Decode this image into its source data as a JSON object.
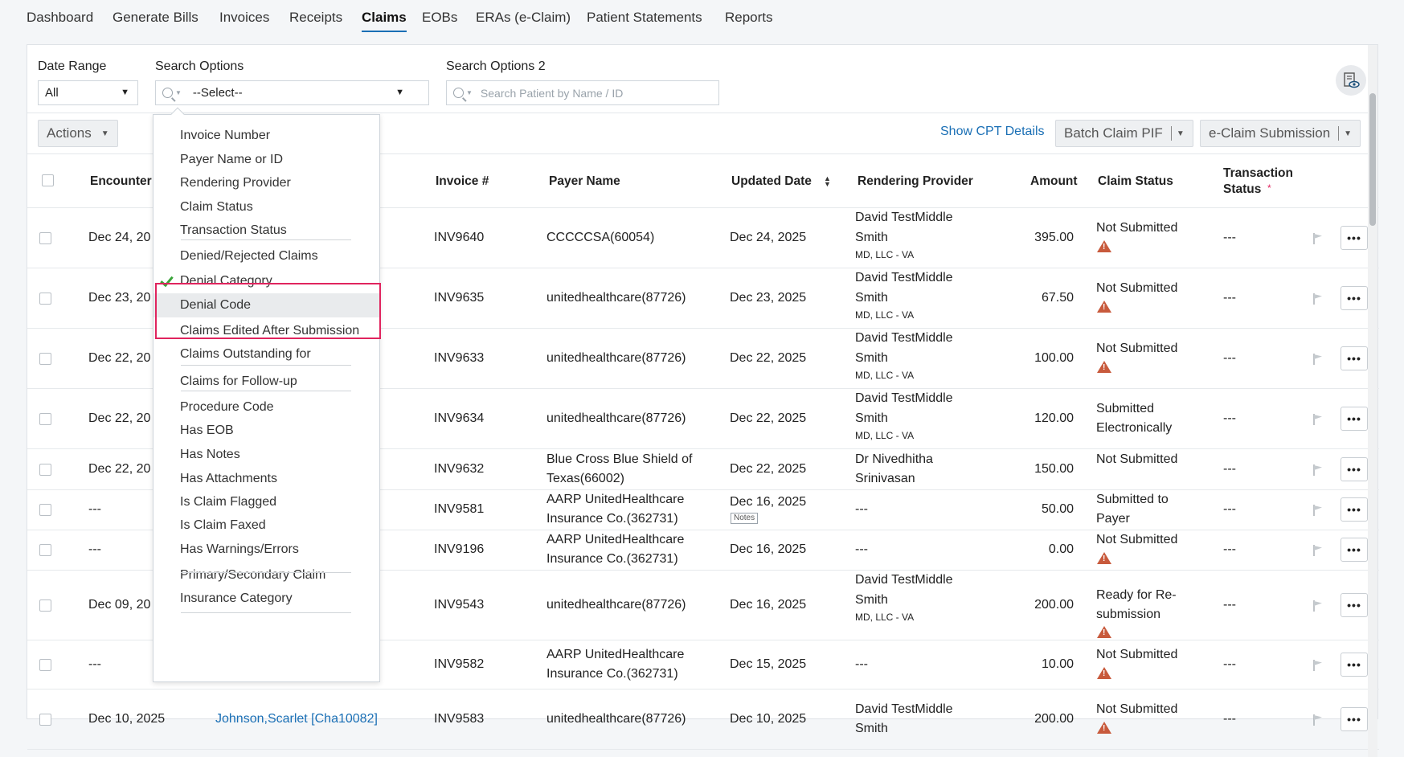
{
  "nav": {
    "tabs": [
      {
        "label": "Dashboard"
      },
      {
        "label": "Generate Bills"
      },
      {
        "label": "Invoices"
      },
      {
        "label": "Receipts"
      },
      {
        "label": "Claims"
      },
      {
        "label": "EOBs"
      },
      {
        "label": "ERAs (e-Claim)"
      },
      {
        "label": "Patient Statements"
      },
      {
        "label": "Reports"
      }
    ],
    "active": "Claims"
  },
  "filters": {
    "date_range_label": "Date Range",
    "date_range_value": "All",
    "search_options_label": "Search Options",
    "search_options_value": "--Select--",
    "search_options2_label": "Search Options 2",
    "search_options2_placeholder": "Search Patient by Name / ID"
  },
  "toolbar": {
    "actions_label": "Actions",
    "show_cpt_label": "Show CPT Details",
    "batch_claim_label": "Batch Claim PIF",
    "eclaim_label": "e-Claim Submission"
  },
  "table": {
    "headers": {
      "encounter": "Encounter",
      "invoice": "Invoice #",
      "payer": "Payer Name",
      "updated": "Updated Date",
      "provider": "Rendering Provider",
      "amount": "Amount",
      "claim_status": "Claim Status",
      "transaction_status_1": "Transaction",
      "transaction_status_2": "Status"
    },
    "rows": [
      {
        "encounter": "Dec 24, 20",
        "patient": "",
        "invoice": "INV9640",
        "payer1": "CCCCCSA(60054)",
        "payer2": "",
        "updated": "Dec 24, 2025",
        "prov1": "David TestMiddle",
        "prov2": "Smith",
        "prov3": "MD, LLC - VA",
        "amount": "395.00",
        "status1": "Not Submitted",
        "status2": "",
        "warn": true,
        "txn": "---"
      },
      {
        "encounter": "Dec 23, 20",
        "patient": "",
        "invoice": "INV9635",
        "payer1": "unitedhealthcare(87726)",
        "payer2": "",
        "updated": "Dec 23, 2025",
        "prov1": "David TestMiddle",
        "prov2": "Smith",
        "prov3": "MD, LLC - VA",
        "amount": "67.50",
        "status1": "Not Submitted",
        "status2": "",
        "warn": true,
        "txn": "---"
      },
      {
        "encounter": "Dec 22, 20",
        "patient": "",
        "invoice": "INV9633",
        "payer1": "unitedhealthcare(87726)",
        "payer2": "",
        "updated": "Dec 22, 2025",
        "prov1": "David TestMiddle",
        "prov2": "Smith",
        "prov3": "MD, LLC - VA",
        "amount": "100.00",
        "status1": "Not Submitted",
        "status2": "",
        "warn": true,
        "txn": "---"
      },
      {
        "encounter": "Dec 22, 20",
        "patient": "",
        "invoice": "INV9634",
        "payer1": "unitedhealthcare(87726)",
        "payer2": "",
        "updated": "Dec 22, 2025",
        "prov1": "David TestMiddle",
        "prov2": "Smith",
        "prov3": "MD, LLC - VA",
        "amount": "120.00",
        "status1": "Submitted",
        "status2": "Electronically",
        "warn": false,
        "txn": "---"
      },
      {
        "encounter": "Dec 22, 20",
        "patient": "",
        "invoice": "INV9632",
        "payer1": "Blue Cross Blue Shield of",
        "payer2": "Texas(66002)",
        "updated": "Dec 22, 2025",
        "prov1": "Dr Nivedhitha",
        "prov2": "Srinivasan",
        "prov3": "",
        "amount": "150.00",
        "status1": "Not Submitted",
        "status2": "",
        "warn": false,
        "txn": "---"
      },
      {
        "encounter": "---",
        "patient": "",
        "invoice": "INV9581",
        "payer1": "AARP UnitedHealthcare",
        "payer2": "Insurance Co.(362731)",
        "updated": "Dec 16, 2025",
        "notes": "Notes",
        "prov1": "---",
        "prov2": "",
        "prov3": "",
        "amount": "50.00",
        "status1": "Submitted to",
        "status2": "Payer",
        "warn": false,
        "txn": "---"
      },
      {
        "encounter": "---",
        "patient": "",
        "invoice": "INV9196",
        "payer1": "AARP UnitedHealthcare",
        "payer2": "Insurance Co.(362731)",
        "updated": "Dec 16, 2025",
        "prov1": "---",
        "prov2": "",
        "prov3": "",
        "amount": "0.00",
        "status1": "Not Submitted",
        "status2": "",
        "warn": true,
        "txn": "---"
      },
      {
        "encounter": "Dec 09, 20",
        "patient": "",
        "invoice": "INV9543",
        "payer1": "unitedhealthcare(87726)",
        "payer2": "",
        "updated": "Dec 16, 2025",
        "prov1": "David TestMiddle",
        "prov2": "Smith",
        "prov3": "MD, LLC - VA",
        "amount": "200.00",
        "status1": "Ready for Re-",
        "status2": "submission",
        "warn": true,
        "txn": "---"
      },
      {
        "encounter": "---",
        "patient": "",
        "invoice": "INV9582",
        "payer1": "AARP UnitedHealthcare",
        "payer2": "Insurance Co.(362731)",
        "updated": "Dec 15, 2025",
        "prov1": "---",
        "prov2": "",
        "prov3": "",
        "amount": "10.00",
        "status1": "Not Submitted",
        "status2": "",
        "warn": true,
        "txn": "---"
      },
      {
        "encounter": "Dec 10, 2025",
        "patient": "Johnson,Scarlet [Cha10082]",
        "invoice": "INV9583",
        "payer1": "unitedhealthcare(87726)",
        "payer2": "",
        "updated": "Dec 10, 2025",
        "prov1": "David TestMiddle",
        "prov2": "Smith",
        "prov3": "",
        "amount": "200.00",
        "status1": "Not Submitted",
        "status2": "",
        "warn": true,
        "txn": "---"
      }
    ]
  },
  "dropdown": {
    "items": [
      "Invoice Number",
      "Payer Name or ID",
      "Rendering Provider",
      "Claim Status",
      "Transaction Status",
      "Denied/Rejected Claims",
      "Denial Category",
      "Denial Code",
      "Claims Edited After Submission",
      "Claims Outstanding for",
      "Claims for Follow-up",
      "Procedure Code",
      "Has EOB",
      "Has Notes",
      "Has Attachments",
      "Is Claim Flagged",
      "Is Claim Faxed",
      "Has Warnings/Errors",
      "Primary/Secondary Claim",
      "Insurance Category"
    ],
    "checked": "Denial Category",
    "highlighted": "Denial Code"
  },
  "colors": {
    "accent": "#1a6fb5",
    "warning": "#c85a3c",
    "check": "#3aa43a",
    "highlight_box": "#e0245e"
  }
}
